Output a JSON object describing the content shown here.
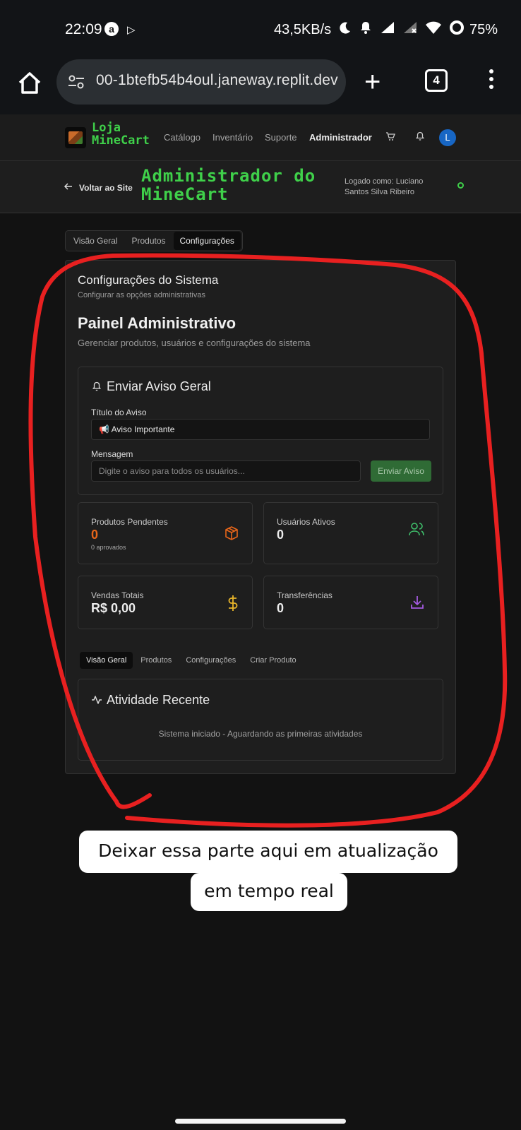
{
  "status_bar": {
    "time": "22:09",
    "amazon_badge": "a",
    "network_speed": "43,5KB/s",
    "battery": "75%"
  },
  "browser": {
    "url": "00-1btefb54b4oul.janeway.replit.dev",
    "tab_count": "4"
  },
  "site_header": {
    "title": "Loja MineCart",
    "nav": [
      "Catálogo",
      "Inventário",
      "Suporte",
      "Administrador"
    ],
    "active_nav": "Administrador",
    "avatar_letter": "L"
  },
  "admin_header": {
    "back_label": "Voltar ao Site",
    "title": "Administrador do MineCart",
    "logged_as": "Logado como: Luciano Santos Silva Ribeiro",
    "status_symbol": "O"
  },
  "top_tabs": [
    "Visão Geral",
    "Produtos",
    "Configurações"
  ],
  "settings_card": {
    "title": "Configurações do Sistema",
    "subtitle": "Configurar as opções administrativas",
    "panel_title": "Painel Administrativo",
    "panel_subtitle": "Gerenciar produtos, usuários e configurações do sistema"
  },
  "notice_form": {
    "heading": "Enviar Aviso Geral",
    "title_label": "Título do Aviso",
    "title_value": "📢 Aviso Importante",
    "message_label": "Mensagem",
    "message_placeholder": "Digite o aviso para todos os usuários...",
    "send_label": "Enviar Aviso"
  },
  "stats": {
    "pending_products": {
      "label": "Produtos Pendentes",
      "value": "0",
      "sub": "0 aprovados",
      "color": "#e8661a"
    },
    "active_users": {
      "label": "Usuários Ativos",
      "value": "0",
      "color": "#3fbf6b"
    },
    "total_sales": {
      "label": "Vendas Totais",
      "value": "R$ 0,00",
      "color": "#e8b52a"
    },
    "transfers": {
      "label": "Transferências",
      "value": "0",
      "color": "#a35ae0"
    }
  },
  "sub_tabs": [
    "Visão Geral",
    "Produtos",
    "Configurações",
    "Criar Produto"
  ],
  "activity": {
    "heading": "Atividade Recente",
    "empty_text": "Sistema iniciado - Aguardando as primeiras atividades"
  },
  "annotation": {
    "line1": "Deixar essa parte aqui em atualização",
    "line2": "em tempo real",
    "color": "#e82020"
  }
}
